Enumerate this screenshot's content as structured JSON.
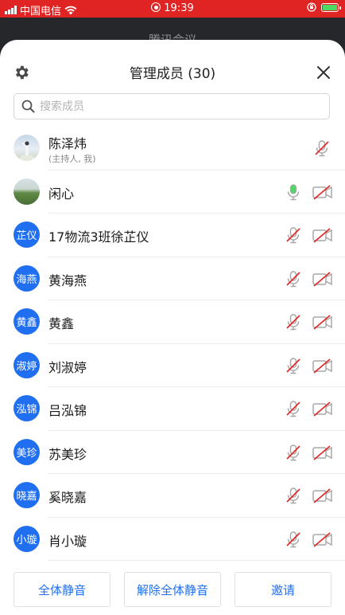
{
  "status_bar": {
    "carrier": "中国电信",
    "time": "19:39"
  },
  "app_header": {
    "title": "腾讯会议"
  },
  "sheet": {
    "title": "管理成员 (30)",
    "search_placeholder": "搜索成员"
  },
  "members": [
    {
      "name": "陈泽炜",
      "subtitle": "(主持人, 我)",
      "avatar_text": "",
      "avatar_style": "photo1",
      "mic": "muted",
      "cam": "none"
    },
    {
      "name": "闲心",
      "avatar_text": "",
      "avatar_style": "photo2",
      "mic": "on",
      "cam": "off"
    },
    {
      "name": "17物流3班徐芷仪",
      "avatar_text": "芷仪",
      "mic": "muted",
      "cam": "off"
    },
    {
      "name": "黄海燕",
      "avatar_text": "海燕",
      "mic": "muted",
      "cam": "off"
    },
    {
      "name": "黄鑫",
      "avatar_text": "黄鑫",
      "mic": "muted",
      "cam": "off"
    },
    {
      "name": "刘淑婷",
      "avatar_text": "淑婷",
      "mic": "muted",
      "cam": "off"
    },
    {
      "name": "吕泓锦",
      "avatar_text": "泓锦",
      "mic": "muted",
      "cam": "off"
    },
    {
      "name": "苏美珍",
      "avatar_text": "美珍",
      "mic": "muted",
      "cam": "off"
    },
    {
      "name": "奚晓嘉",
      "avatar_text": "晓嘉",
      "mic": "muted",
      "cam": "off"
    },
    {
      "name": "肖小璇",
      "avatar_text": "小璇",
      "mic": "muted",
      "cam": "off"
    }
  ],
  "footer": {
    "mute_all": "全体静音",
    "unmute_all": "解除全体静音",
    "invite": "邀请"
  },
  "colors": {
    "accent": "#1f6ff0",
    "status_bar": "#e02424",
    "mic_on": "#4cd964",
    "muted_slash": "#e02424"
  }
}
